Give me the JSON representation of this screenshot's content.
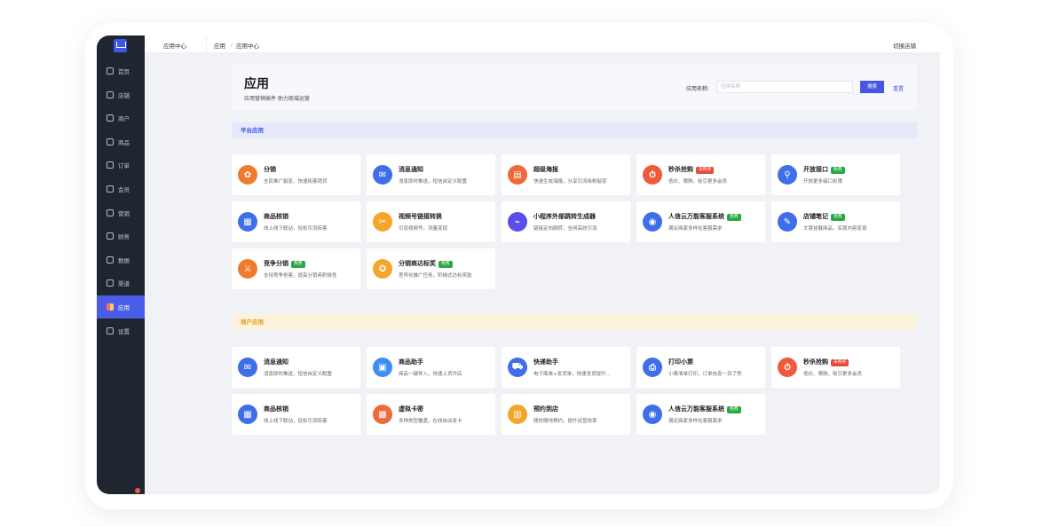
{
  "sidebar": {
    "items": [
      {
        "label": "首页",
        "icon": "home-icon"
      },
      {
        "label": "店铺",
        "icon": "store-icon"
      },
      {
        "label": "商户",
        "icon": "merchant-icon"
      },
      {
        "label": "商品",
        "icon": "goods-icon"
      },
      {
        "label": "订单",
        "icon": "order-icon"
      },
      {
        "label": "会员",
        "icon": "member-icon"
      },
      {
        "label": "营销",
        "icon": "marketing-icon"
      },
      {
        "label": "财务",
        "icon": "finance-icon"
      },
      {
        "label": "数据",
        "icon": "data-icon"
      },
      {
        "label": "渠道",
        "icon": "channel-icon"
      },
      {
        "label": "应用",
        "icon": "apps-icon",
        "active": true
      },
      {
        "label": "设置",
        "icon": "settings-icon"
      }
    ]
  },
  "topbar": {
    "section_title": "应用中心",
    "breadcrumb_root": "应用",
    "breadcrumb_sep": "/",
    "breadcrumb_current": "应用中心",
    "switch_store": "切换店铺"
  },
  "hero": {
    "title": "应用",
    "subtitle": "应用营销插件 助力商城运营",
    "search_label": "应用名称:",
    "search_placeholder": "应用名称",
    "search_button": "搜索",
    "reset_link": "重置"
  },
  "platform": {
    "section_title": "平台应用",
    "apps": [
      {
        "title": "分销",
        "desc": "全民推广裂变，快速拓客销货",
        "color": "#f07b2f",
        "glyph": "✿",
        "icon": "share-network-icon"
      },
      {
        "title": "消息通知",
        "desc": "消息即时推送，短信自定义配置",
        "color": "#3f6fe8",
        "glyph": "✉",
        "icon": "message-icon"
      },
      {
        "title": "超级海报",
        "desc": "快速生成海报，分享引流吸粉裂变",
        "color": "#ef6a3a",
        "glyph": "▤",
        "icon": "poster-icon"
      },
      {
        "title": "秒杀抢购",
        "desc": "低价、限购，吸引更多会员",
        "color": "#ef5a3a",
        "glyph": "⏱",
        "icon": "flash-sale-icon",
        "badge": "未购买",
        "badge_type": "red"
      },
      {
        "title": "开放接口",
        "desc": "开放更多接口权限",
        "color": "#3f6fe8",
        "glyph": "⚲",
        "icon": "api-icon",
        "badge": "免费",
        "badge_type": "green"
      },
      {
        "title": "商品核销",
        "desc": "线上线下联动，轻松引流拓客",
        "color": "#3f6fe8",
        "glyph": "▦",
        "icon": "verify-icon"
      },
      {
        "title": "视频号链接转换",
        "desc": "引流视频号，流量变现",
        "color": "#f4a52b",
        "glyph": "✂",
        "icon": "video-link-icon"
      },
      {
        "title": "小程序外部跳转生成器",
        "desc": "链接定向跳转，全网高效引流",
        "color": "#5b4ee8",
        "glyph": "⌁",
        "icon": "jump-link-icon"
      },
      {
        "title": "人信云万能客服系统",
        "desc": "满足商家多样化客服需求",
        "color": "#3f6fe8",
        "glyph": "◉",
        "icon": "customer-service-icon",
        "badge": "免费",
        "badge_type": "green"
      },
      {
        "title": "店铺笔记",
        "desc": "文章挂载商品，实现内容变现",
        "color": "#3f6fe8",
        "glyph": "✎",
        "icon": "notes-icon",
        "badge": "免费",
        "badge_type": "green"
      },
      {
        "title": "竞争分销",
        "desc": "支持竞争抢客，提高分销商积极性",
        "color": "#f07b2f",
        "glyph": "⚔",
        "icon": "compete-icon",
        "badge": "免费",
        "badge_type": "green"
      },
      {
        "title": "分销商达标奖",
        "desc": "差异化推广任务，阶梯式达标奖励",
        "color": "#f4a52b",
        "glyph": "✪",
        "icon": "award-icon",
        "badge": "免费",
        "badge_type": "green"
      }
    ]
  },
  "merchant": {
    "section_title": "商户应用",
    "apps": [
      {
        "title": "消息通知",
        "desc": "消息即时推送，短信自定义配置",
        "color": "#3f6fe8",
        "glyph": "✉",
        "icon": "message-icon"
      },
      {
        "title": "商品助手",
        "desc": "商品一键导入，快速上货开店",
        "color": "#3f8ef0",
        "glyph": "▣",
        "icon": "goods-helper-icon"
      },
      {
        "title": "快递助手",
        "desc": "电子面单+发货单，快速发货提升...",
        "color": "#3f6fe8",
        "glyph": "⛟",
        "icon": "express-icon"
      },
      {
        "title": "打印小票",
        "desc": "小票清单打印，订单信息一目了然",
        "color": "#3f6fe8",
        "glyph": "⎙",
        "icon": "print-icon"
      },
      {
        "title": "秒杀抢购",
        "desc": "低价、限购，吸引更多会员",
        "color": "#ef5a3a",
        "glyph": "⏱",
        "icon": "flash-sale-icon",
        "badge": "未购买",
        "badge_type": "red"
      },
      {
        "title": "商品核销",
        "desc": "线上线下联动，轻松引流拓客",
        "color": "#3f6fe8",
        "glyph": "▦",
        "icon": "verify-icon"
      },
      {
        "title": "虚拟卡密",
        "desc": "多种类型覆盖，在线自动发卡",
        "color": "#ef6a3a",
        "glyph": "▩",
        "icon": "virtual-card-icon"
      },
      {
        "title": "预约到店",
        "desc": "随时随地预约，提升运营效率",
        "color": "#f4a52b",
        "glyph": "▥",
        "icon": "reservation-icon"
      },
      {
        "title": "人信云万能客服系统",
        "desc": "满足商家多样化客服需求",
        "color": "#3f6fe8",
        "glyph": "◉",
        "icon": "customer-service-icon",
        "badge": "免费",
        "badge_type": "green"
      }
    ]
  },
  "colors": {
    "accent": "#4757e3",
    "sidebar_bg": "#1f2630",
    "platform_section_bg": "#e6e9fb",
    "merchant_section_bg": "#fdf3dc",
    "platform_section_text": "#3b55e6",
    "merchant_section_text": "#e09a24"
  }
}
